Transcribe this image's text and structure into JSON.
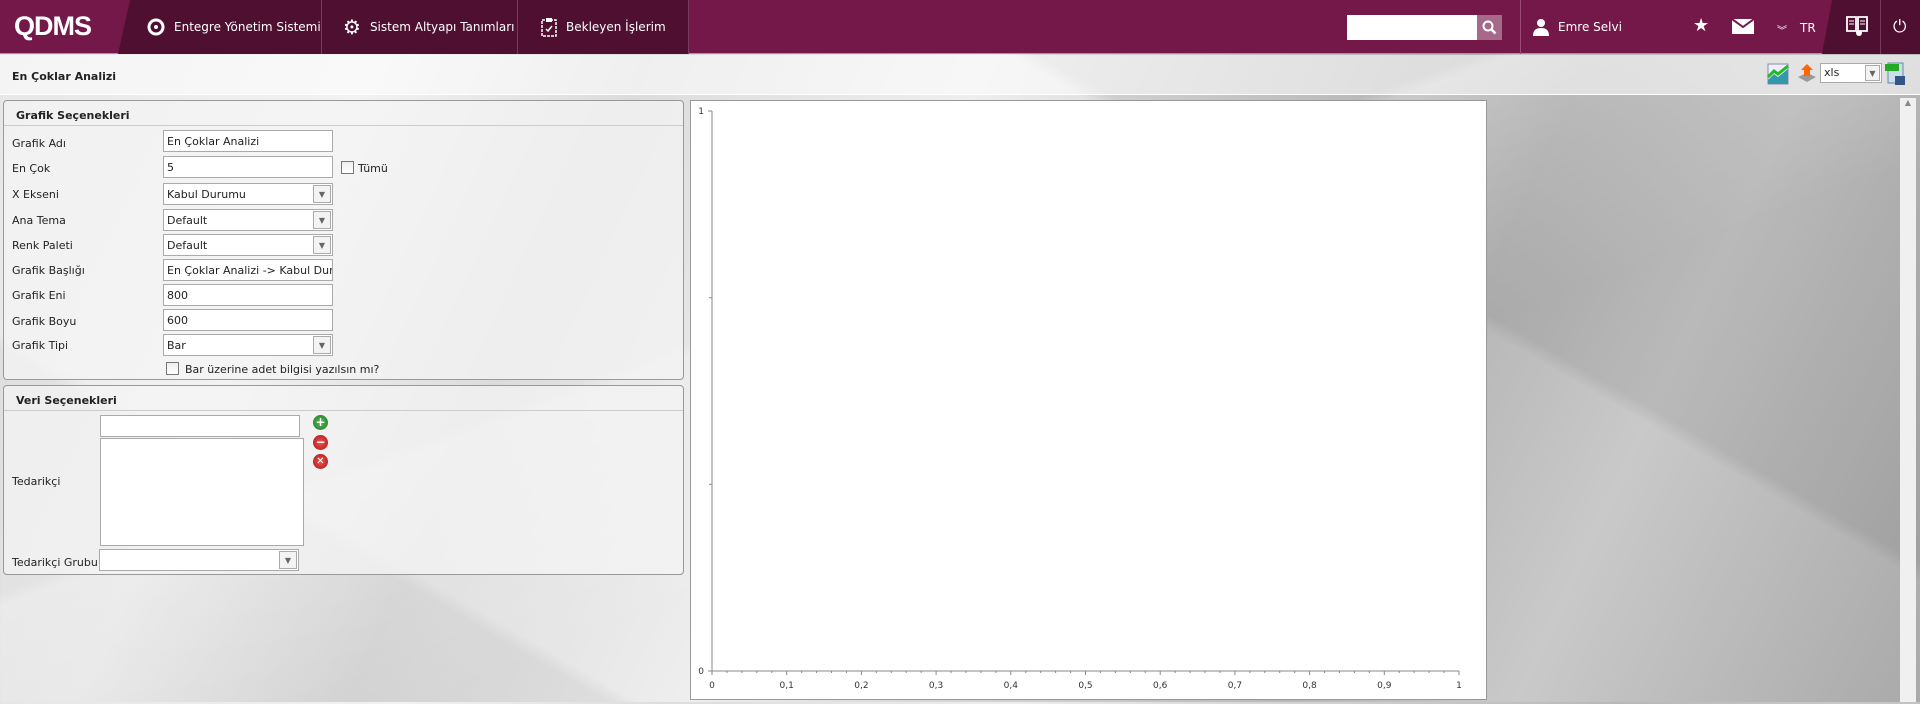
{
  "header": {
    "logo": "QDMS",
    "nav": [
      {
        "label": "Entegre Yönetim Sistemi",
        "icon": "qdms-icon"
      },
      {
        "label": "Sistem Altyapı Tanımları",
        "icon": "gear-icon"
      },
      {
        "label": "Bekleyen İşlerim",
        "icon": "clipboard-icon"
      }
    ],
    "search_value": "",
    "user": "Emre Selvi",
    "language": "TR"
  },
  "page": {
    "title": "En Çoklar Analizi",
    "export_format": "xls"
  },
  "grafik": {
    "title": "Grafik Seçenekleri",
    "fields": [
      {
        "label": "Grafik Adı",
        "value": "En Çoklar Analizi",
        "type": "text"
      },
      {
        "label": "En Çok",
        "value": "5",
        "type": "text"
      },
      {
        "label": "X Ekseni",
        "value": "Kabul Durumu",
        "type": "select"
      },
      {
        "label": "Ana Tema",
        "value": "Default",
        "type": "select"
      },
      {
        "label": "Renk Paleti",
        "value": "Default",
        "type": "select"
      },
      {
        "label": "Grafik Başlığı",
        "value": "En Çoklar Analizi -> Kabul Durum",
        "type": "text"
      },
      {
        "label": "Grafik Eni",
        "value": "800",
        "type": "text"
      },
      {
        "label": "Grafik Boyu",
        "value": "600",
        "type": "text"
      },
      {
        "label": "Grafik Tipi",
        "value": "Bar",
        "type": "select"
      }
    ],
    "tumu_label": "Tümü",
    "bar_label_checkbox": "Bar üzerine adet bilgisi yazılsın mı?"
  },
  "veri": {
    "title": "Veri Seçenekleri",
    "tedarikci_label": "Tedarikçi",
    "tedarikci_input": "",
    "tedarikci_grubu_label": "Tedarikçi Grubu",
    "tedarikci_grubu_value": ""
  },
  "chart_data": {
    "type": "bar",
    "categories": [],
    "values": [],
    "title": "",
    "xlabel": "",
    "ylabel": "",
    "xlim": [
      0,
      1
    ],
    "ylim": [
      0,
      1
    ],
    "x_ticks": [
      "0",
      "0,1",
      "0,2",
      "0,3",
      "0,4",
      "0,5",
      "0,6",
      "0,7",
      "0,8",
      "0,9",
      "1"
    ],
    "y_ticks": [
      "0",
      "1"
    ]
  }
}
